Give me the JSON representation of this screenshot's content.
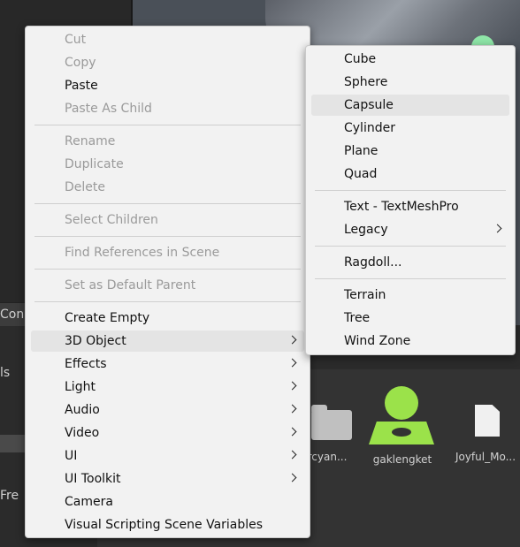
{
  "context_menu": {
    "items": [
      {
        "label": "Cut",
        "enabled": false
      },
      {
        "label": "Copy",
        "enabled": false
      },
      {
        "label": "Paste",
        "enabled": true
      },
      {
        "label": "Paste As Child",
        "enabled": false
      },
      {
        "label": "Rename",
        "enabled": false
      },
      {
        "label": "Duplicate",
        "enabled": false
      },
      {
        "label": "Delete",
        "enabled": false
      },
      {
        "label": "Select Children",
        "enabled": false
      },
      {
        "label": "Find References in Scene",
        "enabled": false
      },
      {
        "label": "Set as Default Parent",
        "enabled": false
      },
      {
        "label": "Create Empty",
        "enabled": true
      },
      {
        "label": "3D Object",
        "enabled": true,
        "submenu": true,
        "highlighted": true
      },
      {
        "label": "Effects",
        "enabled": true,
        "submenu": true
      },
      {
        "label": "Light",
        "enabled": true,
        "submenu": true
      },
      {
        "label": "Audio",
        "enabled": true,
        "submenu": true
      },
      {
        "label": "Video",
        "enabled": true,
        "submenu": true
      },
      {
        "label": "UI",
        "enabled": true,
        "submenu": true
      },
      {
        "label": "UI Toolkit",
        "enabled": true,
        "submenu": true
      },
      {
        "label": "Camera",
        "enabled": true
      },
      {
        "label": "Visual Scripting Scene Variables",
        "enabled": true
      }
    ]
  },
  "submenu_3d_object": {
    "items": [
      {
        "label": "Cube"
      },
      {
        "label": "Sphere"
      },
      {
        "label": "Capsule",
        "highlighted": true
      },
      {
        "label": "Cylinder"
      },
      {
        "label": "Plane"
      },
      {
        "label": "Quad"
      },
      {
        "label": "Text - TextMeshPro"
      },
      {
        "label": "Legacy",
        "submenu": true
      },
      {
        "label": "Ragdoll..."
      },
      {
        "label": "Terrain"
      },
      {
        "label": "Tree"
      },
      {
        "label": "Wind Zone"
      }
    ]
  },
  "background": {
    "console_tab": "Cons",
    "side_label_1": "ls",
    "side_label_2": "Fre",
    "assets": [
      {
        "name": "rcyan...",
        "icon": "folder-icon"
      },
      {
        "name": "gaklengket",
        "icon": "prefab-icon"
      },
      {
        "name": "Joyful_Mo...",
        "icon": "document-icon"
      }
    ]
  },
  "colors": {
    "menu_bg": "#f2f2f2",
    "highlight": "#e4e4e4",
    "disabled_text": "#9a9a9a",
    "prefab_green": "#9be24a"
  }
}
